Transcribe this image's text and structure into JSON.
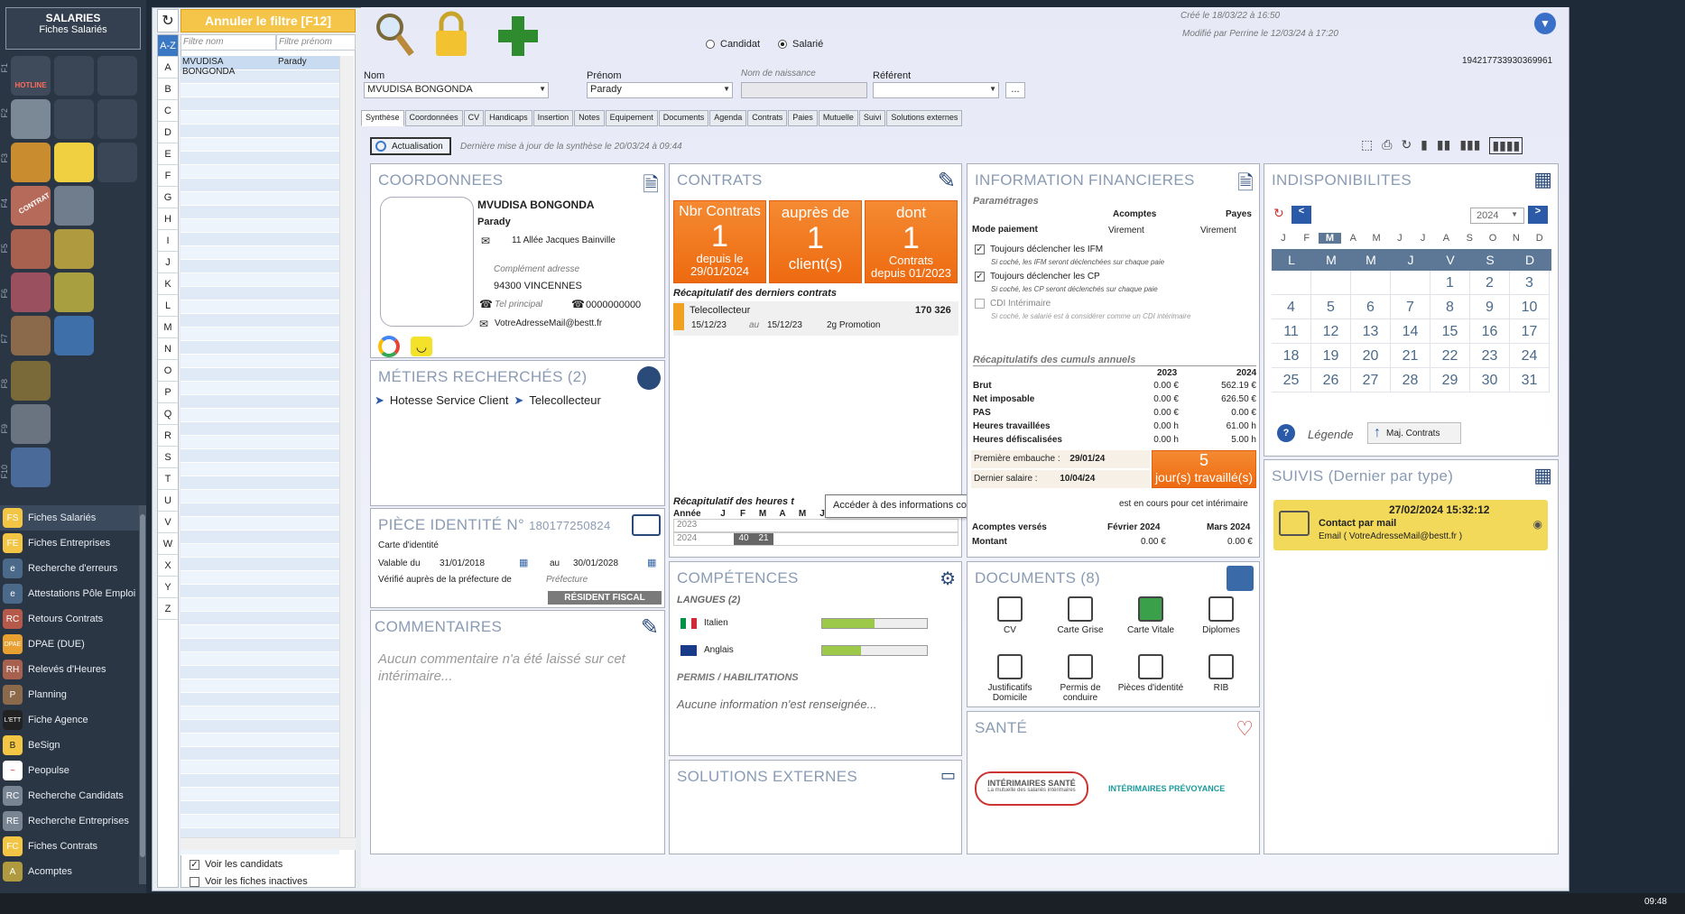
{
  "sidebar": {
    "title": "SALARIES",
    "subtitle": "Fiches Salariés",
    "fkeys": [
      "F1",
      "F2",
      "F3",
      "F4",
      "F5",
      "F6",
      "F7",
      "F8",
      "F9",
      "F10"
    ],
    "hotline": "HOTLINE",
    "contrat_tile": "CONTRAT",
    "nav": [
      {
        "label": "Fiches Salariés",
        "icon": "FS"
      },
      {
        "label": "Fiches Entreprises",
        "icon": "FE"
      },
      {
        "label": "Recherche d'erreurs",
        "icon": "e"
      },
      {
        "label": "Attestations Pôle Emploi",
        "icon": "e"
      },
      {
        "label": "Retours Contrats",
        "icon": "RC"
      },
      {
        "label": "DPAE (DUE)",
        "icon": "DPAE"
      },
      {
        "label": "Relevés d'Heures",
        "icon": "RH"
      },
      {
        "label": "Planning",
        "icon": "P"
      },
      {
        "label": "Fiche Agence",
        "icon": "L'ETT"
      },
      {
        "label": "BeSign",
        "icon": "B"
      },
      {
        "label": "Peopulse",
        "icon": "~"
      },
      {
        "label": "Recherche Candidats",
        "icon": "RC"
      },
      {
        "label": "Recherche Entreprises",
        "icon": "RE"
      },
      {
        "label": "Fiches Contrats",
        "icon": "FC"
      },
      {
        "label": "Acomptes",
        "icon": "A"
      }
    ]
  },
  "list": {
    "filter_btn": "Annuler le filtre [F12]",
    "az": "A-Z",
    "letters": [
      "A",
      "B",
      "C",
      "D",
      "E",
      "F",
      "G",
      "H",
      "I",
      "J",
      "K",
      "L",
      "M",
      "N",
      "O",
      "P",
      "Q",
      "R",
      "S",
      "T",
      "U",
      "V",
      "W",
      "X",
      "Y",
      "Z"
    ],
    "ph_nom": "Filtre nom",
    "ph_prenom": "Filtre prénom",
    "row_nom": "MVUDISA BONGONDA",
    "row_prenom": "Parady",
    "chk_candidats": "Voir les candidats",
    "chk_inactives": "Voir les fiches inactives"
  },
  "header": {
    "radio_candidat": "Candidat",
    "radio_salarie": "Salarié",
    "created": "Créé le 18/03/22 à 16:50",
    "modified": "Modifié par Perrine le 12/03/24 à 17:20",
    "id_number": "194217733930369961",
    "lbl_nom": "Nom",
    "val_nom": "MVUDISA BONGONDA",
    "lbl_prenom": "Prénom",
    "val_prenom": "Parady",
    "lbl_naissance": "Nom de naissance",
    "lbl_referent": "Référent",
    "ellipsis": "..."
  },
  "tabs": [
    "Synthèse",
    "Coordonnées",
    "CV",
    "Handicaps",
    "Insertion",
    "Notes",
    "Equipement",
    "Documents",
    "Agenda",
    "Contrats",
    "Paies",
    "Mutuelle",
    "Suivi",
    "Solutions externes"
  ],
  "actualisation": {
    "btn": "Actualisation",
    "note": "Dernière mise à jour de la synthèse le 20/03/24 à 09:44"
  },
  "coord": {
    "title": "COORDONNEES",
    "name": "MVUDISA BONGONDA",
    "firstname": "Parady",
    "address": "11 Allée Jacques Bainville",
    "complement": "Complément adresse",
    "city": "94300 VINCENNES",
    "tel_label": "Tel principal",
    "tel": "0000000000",
    "email": "VotreAdresseMail@bestt.fr"
  },
  "metiers": {
    "title": "MÉTIERS RECHERCHÉS (2)",
    "items": [
      "Hotesse Service Client",
      "Telecollecteur"
    ]
  },
  "piece": {
    "title": "PIÈCE IDENTITÉ N°",
    "number": "180177250824",
    "type": "Carte d'identité",
    "valable": "Valable du",
    "from": "31/01/2018",
    "au": "au",
    "to": "30/01/2028",
    "verif": "Vérifié auprès de la préfecture de",
    "prefecture": "Préfecture",
    "badge": "RÉSIDENT FISCAL"
  },
  "comments": {
    "title": "COMMENTAIRES",
    "empty": "Aucun commentaire n'a été laissé sur cet intérimaire..."
  },
  "contrats": {
    "title": "CONTRATS",
    "boxes": [
      {
        "head": "Nbr Contrats",
        "num": "1",
        "sub1": "depuis le",
        "sub2": "29/01/2024"
      },
      {
        "head": "auprès de",
        "num": "1",
        "sub1": "client(s)",
        "sub2": ""
      },
      {
        "head": "dont",
        "num": "1",
        "sub1": "Contrats",
        "sub2": "depuis 01/2023"
      }
    ],
    "recap_title": "Récapitulatif des derniers contrats",
    "last": {
      "job": "Telecollecteur",
      "num": "170 326",
      "from": "15/12/23",
      "au": "au",
      "to": "15/12/23",
      "client": "2g Promotion"
    },
    "hours_title": "Récapitulatif des heures t",
    "hours_head": [
      "Année",
      "J",
      "F",
      "M",
      "A",
      "M",
      "J"
    ],
    "y2023": "2023",
    "y2024": "2024",
    "h_f": "40",
    "h_m": "21"
  },
  "tooltip": "Accéder à des informations complémentaires sur ce contrat",
  "competences": {
    "title": "COMPÉTENCES",
    "langs_title": "LANGUES (2)",
    "langs": [
      {
        "name": "Italien",
        "level": 0.5
      },
      {
        "name": "Anglais",
        "level": 0.37
      }
    ],
    "permis_title": "PERMIS / HABILITATIONS",
    "permis_empty": "Aucune information n'est renseignée..."
  },
  "solutions": {
    "title": "SOLUTIONS EXTERNES"
  },
  "finance": {
    "title": "INFORMATION FINANCIERES",
    "param": "Paramétrages",
    "acomptes": "Acomptes",
    "payes": "Payes",
    "mode": "Mode paiement",
    "v1": "Virement",
    "v2": "Virement",
    "ifm": "Toujours déclencher les IFM",
    "ifm_note": "Si coché, les IFM seront déclenchées sur chaque paie",
    "cp": "Toujours déclencher les CP",
    "cp_note": "Si coché, les CP seront déclenchés sur chaque paie",
    "cdi": "CDI Intérimaire",
    "cdi_note": "Si coché, le salarié est à considérer comme un CDI intérimaire",
    "recap": "Récapitulatifs des cumuls annuels",
    "y1": "2023",
    "y2": "2024",
    "rows": [
      {
        "l": "Brut",
        "a": "0.00 €",
        "b": "562.19 €"
      },
      {
        "l": "Net imposable",
        "a": "0.00 €",
        "b": "626.50 €"
      },
      {
        "l": "PAS",
        "a": "0.00 €",
        "b": "0.00 €"
      },
      {
        "l": "Heures travaillées",
        "a": "0.00 h",
        "b": "61.00 h"
      },
      {
        "l": "Heures défiscalisées",
        "a": "0.00 h",
        "b": "5.00 h"
      }
    ],
    "emb_l": "Première embauche :",
    "emb": "29/01/24",
    "sal_l": "Dernier salaire :",
    "sal": "10/04/24",
    "jours_num": "5",
    "jours_txt": "jour(s) travaillé(s)",
    "encours": "est en cours pour cet intérimaire",
    "ac_versés": "Acomptes versés",
    "m1": "Février 2024",
    "m2": "Mars 2024",
    "montant": "Montant",
    "m1v": "0.00 €",
    "m2v": "0.00 €"
  },
  "documents": {
    "title": "DOCUMENTS (8)",
    "items": [
      "CV",
      "Carte Grise",
      "Carte Vitale",
      "Diplomes",
      "Justificatifs Domicile",
      "Permis de conduire",
      "Pièces d'identité",
      "RIB"
    ]
  },
  "sante": {
    "title": "SANTÉ",
    "logo1": "INTÉRIMAIRES SANTÉ",
    "logo1b": "La mutuelle des salariés intérimaires",
    "logo2": "INTÉRIMAIRES PRÉVOYANCE"
  },
  "indispo": {
    "title": "INDISPONIBILITES",
    "year": "2024",
    "months": [
      "J",
      "F",
      "M",
      "A",
      "M",
      "J",
      "J",
      "A",
      "S",
      "O",
      "N",
      "D"
    ],
    "days": [
      "L",
      "M",
      "M",
      "J",
      "V",
      "S",
      "D"
    ],
    "cells": [
      "",
      "",
      "",
      "",
      "1",
      "2",
      "3",
      "4",
      "5",
      "6",
      "7",
      "8",
      "9",
      "10",
      "11",
      "12",
      "13",
      "14",
      "15",
      "16",
      "17",
      "18",
      "19",
      "20",
      "21",
      "22",
      "23",
      "24",
      "25",
      "26",
      "27",
      "28",
      "29",
      "30",
      "31"
    ],
    "legende": "Légende",
    "maj": "Maj. Contrats"
  },
  "suivis": {
    "title": "SUIVIS (Dernier par type)",
    "date": "27/02/2024 15:32:12",
    "what": "Contact par mail",
    "detail": "Email ( VotreAdresseMail@bestt.fr )"
  },
  "clock": "09:48",
  "colors": {
    "orange": "#ef7420",
    "yellow": "#f5c54a",
    "title_grey": "#8a9bb4",
    "green_plus": "#2e8b2e",
    "cal_head": "#5c7896"
  }
}
